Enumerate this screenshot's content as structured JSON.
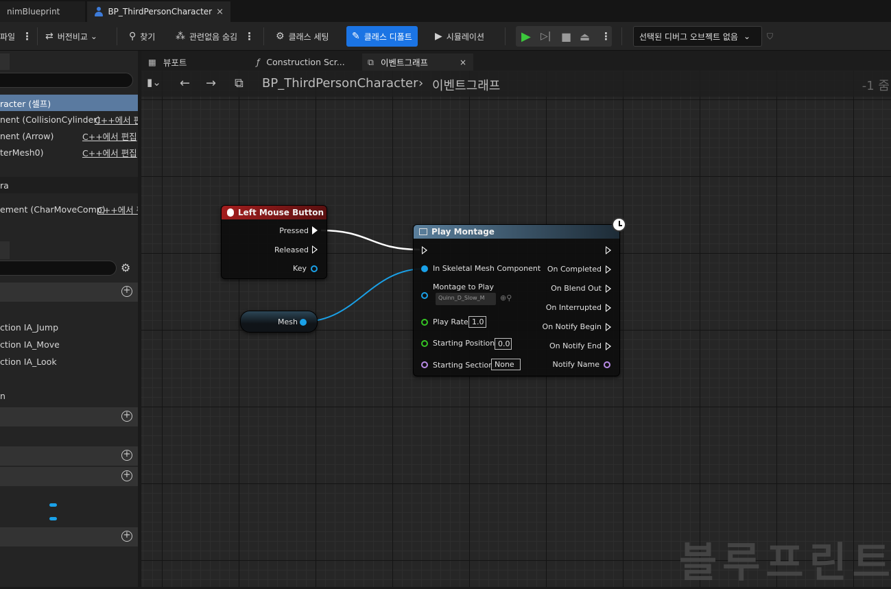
{
  "tabs": {
    "tab1": "nimBlueprint",
    "tab2": "BP_ThirdPersonCharacter",
    "close": "×"
  },
  "toolbar": {
    "file": "파일",
    "diff": "버전비교",
    "find": "찾기",
    "hide_unrelated": "관련없음 숨김",
    "class_settings": "클래스 세팅",
    "class_defaults": "클래스 디폴트",
    "simulation": "시뮬레이션",
    "debug_object": "선택된 디버그 오브젝트 없음"
  },
  "components": {
    "rows": [
      {
        "label": "racter (셀프)"
      },
      {
        "label": "nent (CollisionCylinder)",
        "cpp": "C++에서 편"
      },
      {
        "label": "nent (Arrow)",
        "cpp": "C++에서 편집"
      },
      {
        "label": "terMesh0)",
        "cpp": "C++에서 편집"
      },
      {
        "label": "ra"
      },
      {
        "label": "ement (CharMoveComp)",
        "cpp": "C++에서 편"
      }
    ]
  },
  "my_blueprint": {
    "actions": [
      "ction IA_Jump",
      "ction IA_Move",
      "ction IA_Look"
    ],
    "misc": "n"
  },
  "graph_tabs": {
    "viewport": "뷰포트",
    "construction": "Construction Scr...",
    "event_graph": "이벤트그래프"
  },
  "breadcrumb": {
    "blueprint": "BP_ThirdPersonCharacter",
    "graph": "이벤트그래프",
    "zoom": "-1 줌"
  },
  "watermark": "블루프린트",
  "nodes": {
    "lmb": {
      "title": "Left Mouse Button",
      "pressed": "Pressed",
      "released": "Released",
      "key": "Key"
    },
    "mesh": {
      "label": "Mesh"
    },
    "play_montage": {
      "title": "Play Montage",
      "in_skeletal": "In Skeletal Mesh Component",
      "montage_to_play": "Montage to Play",
      "montage_value": "Quinn_D_Slow_M",
      "play_rate": "Play Rate",
      "play_rate_value": "1.0",
      "starting_position": "Starting Position",
      "starting_position_value": "0.0",
      "starting_section": "Starting Section",
      "starting_section_value": "None",
      "on_completed": "On Completed",
      "on_blend_out": "On Blend Out",
      "on_interrupted": "On Interrupted",
      "on_notify_begin": "On Notify Begin",
      "on_notify_end": "On Notify End",
      "notify_name": "Notify Name"
    }
  },
  "colors": {
    "accent": "#1b74e4",
    "event_header": "#8b1e1e",
    "object_pin": "#1aa1e8",
    "float_pin": "#35c424",
    "name_pin": "#b98be6",
    "play_green": "#3cc83c"
  }
}
